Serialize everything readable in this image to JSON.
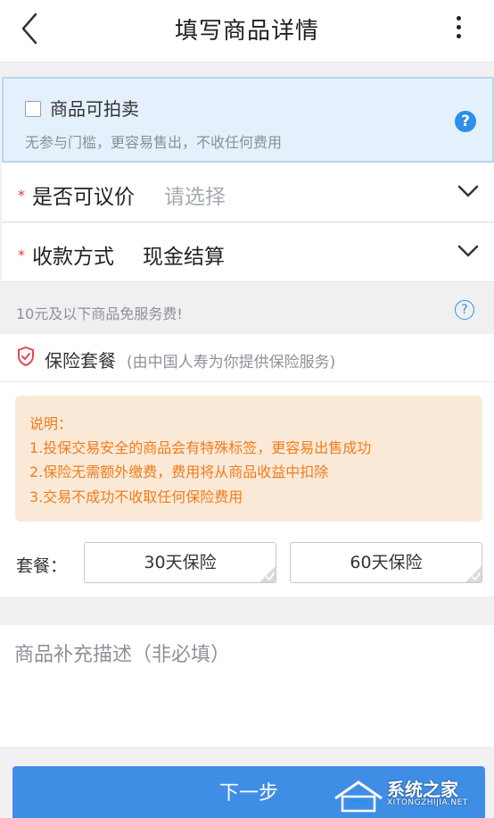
{
  "header": {
    "title": "填写商品详情",
    "back_icon": "chevron-left-icon",
    "more_icon": "more-vertical-icon"
  },
  "auction": {
    "checkbox_label": "商品可拍卖",
    "checked": false,
    "description": "无参与门槛，更容易售出，不收任何费用",
    "help_icon": "question-circle-filled-icon"
  },
  "negotiable": {
    "required_mark": "*",
    "label": "是否可议价",
    "placeholder": "请选择",
    "chevron_icon": "chevron-down-icon"
  },
  "payment": {
    "required_mark": "*",
    "label": "收款方式",
    "value": "现金结算",
    "chevron_icon": "chevron-down-icon"
  },
  "fee_notice": {
    "text": "10元及以下商品免服务费!",
    "help_icon": "question-circle-outline-icon"
  },
  "insurance": {
    "icon": "shield-icon",
    "title": "保险套餐",
    "provider": "(由中国人寿为你提供保险服务)",
    "notes": [
      "说明：",
      "1.投保交易安全的商品会有特殊标签，更容易出售成功",
      "2.保险无需额外缴费，费用将从商品收益中扣除",
      "3.交易不成功不收取任何保险费用"
    ],
    "package_label": "套餐：",
    "packages": [
      "30天保险",
      "60天保险"
    ]
  },
  "description": {
    "placeholder": "商品补充描述（非必填）",
    "value": ""
  },
  "next_button": {
    "label": "下一步"
  },
  "watermark": {
    "brand": "系统之家",
    "domain": "XITONGZHIJIA.NET"
  },
  "colors": {
    "accent_blue": "#3f8ee6",
    "required_red": "#e53935",
    "notice_orange": "#f07d1a",
    "notes_background": "#fbe9d8",
    "auction_background": "#e4f1fc"
  }
}
